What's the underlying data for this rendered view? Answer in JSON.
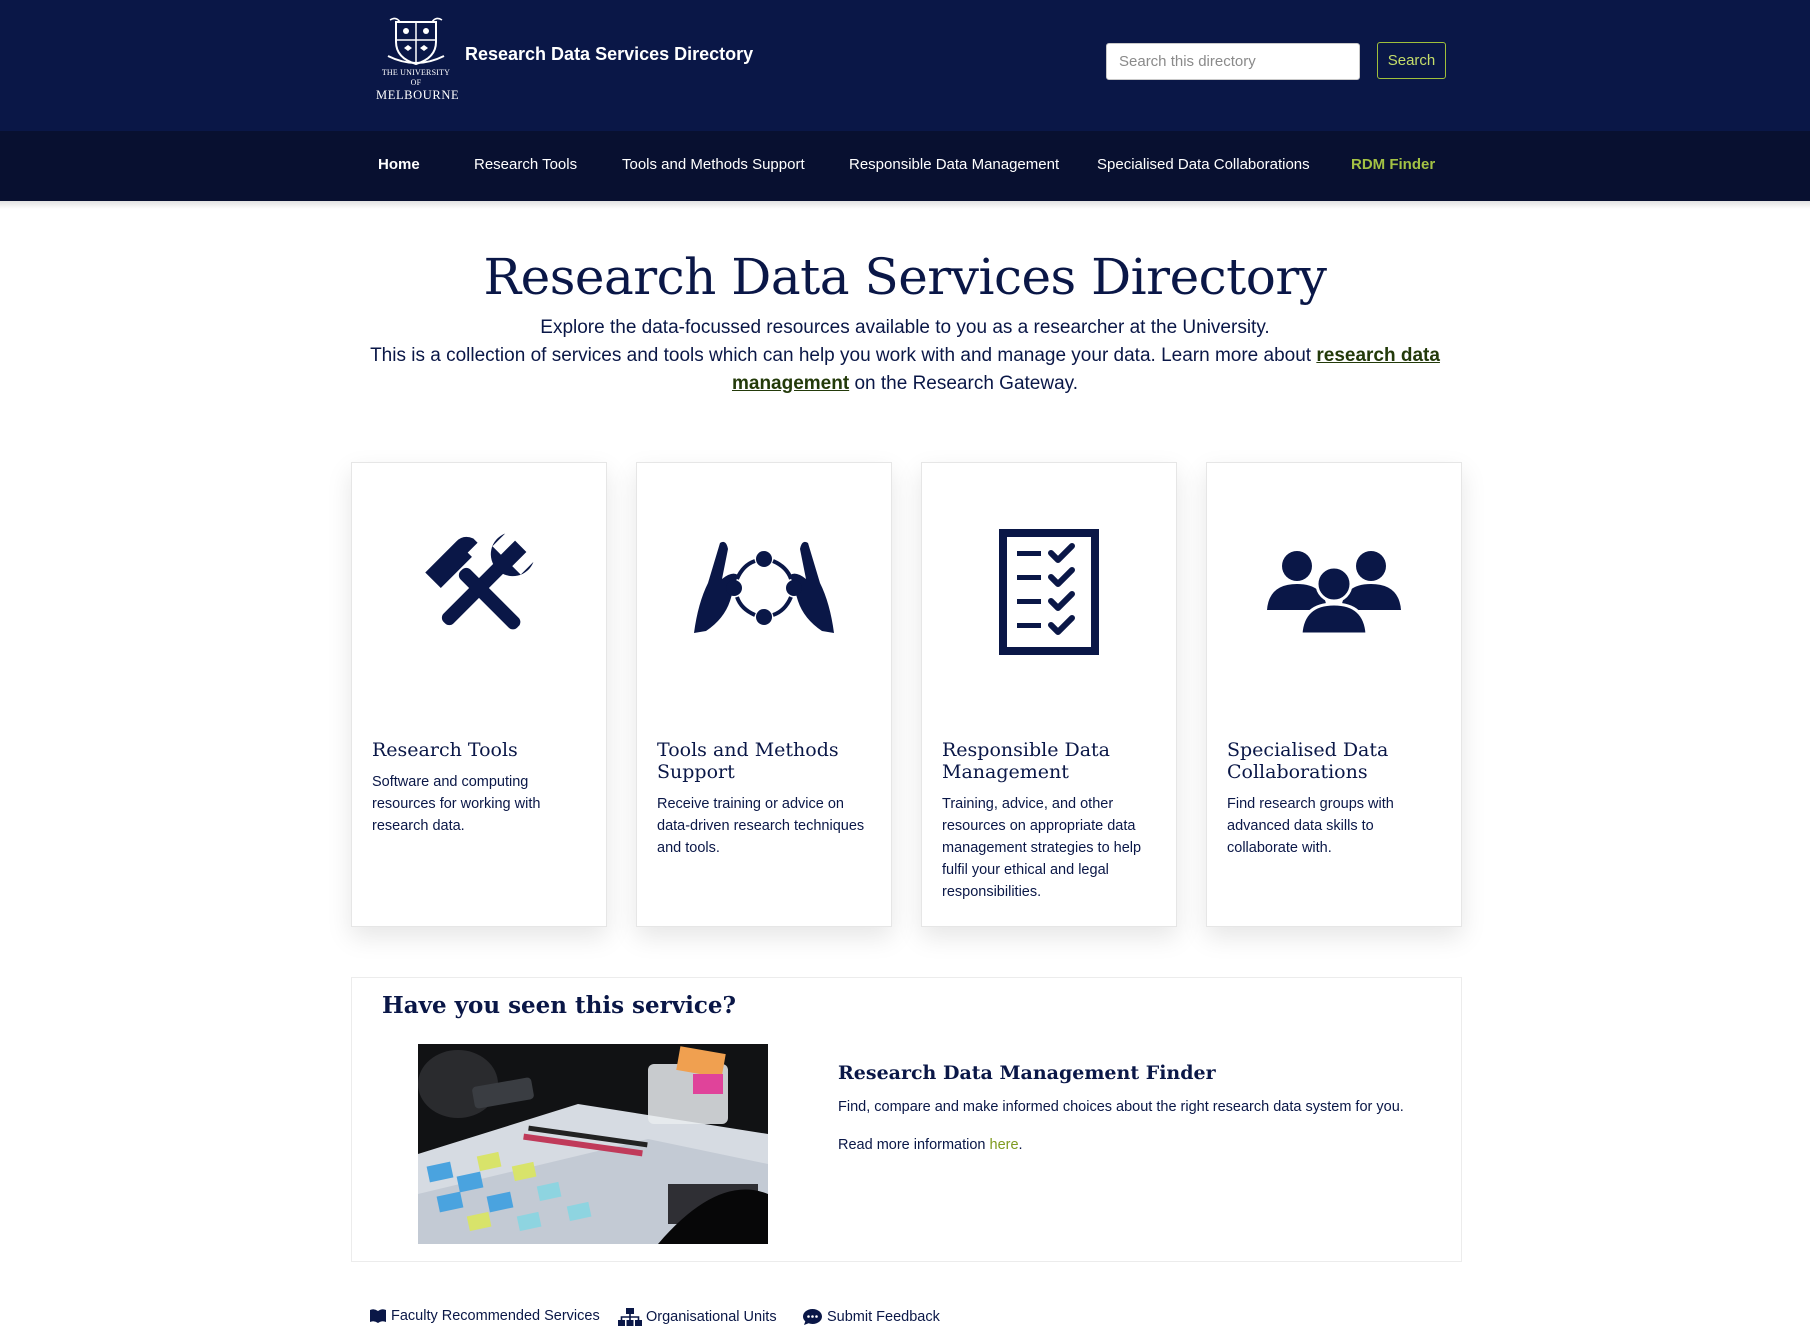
{
  "header": {
    "logo_small": "THE UNIVERSITY OF",
    "logo_big": "MELBOURNE",
    "site_title": "Research Data Services Directory",
    "search_placeholder": "Search this directory",
    "search_button": "Search"
  },
  "nav": {
    "items": [
      {
        "label": "Home"
      },
      {
        "label": "Research Tools"
      },
      {
        "label": "Tools and Methods Support"
      },
      {
        "label": "Responsible Data Management"
      },
      {
        "label": "Specialised Data Collaborations"
      },
      {
        "label": "RDM Finder"
      }
    ]
  },
  "hero": {
    "title": "Research Data Services Directory",
    "line1": "Explore the data-focussed resources available to you as a researcher at the University.",
    "line2_pre": "This is a collection of services and tools which can help you work with and manage your data. Learn more about ",
    "line2_link": "research data management",
    "line2_post": " on the Research Gateway."
  },
  "cards": [
    {
      "icon": "tools-icon",
      "title": "Research Tools",
      "desc": "Software and computing resources for working with research data."
    },
    {
      "icon": "hands-cycle-icon",
      "title": "Tools and Methods Support",
      "desc": "Receive training or advice on data-driven research techniques and tools."
    },
    {
      "icon": "checklist-icon",
      "title": "Responsible Data Management",
      "desc": "Training, advice, and other resources on appropriate data management strategies to help fulfil your ethical and legal responsibilities."
    },
    {
      "icon": "group-icon",
      "title": "Specialised Data Collaborations",
      "desc": "Find research groups with advanced data skills to collaborate with."
    }
  ],
  "featured": {
    "heading": "Have you seen this service?",
    "title": "Research Data Management Finder",
    "desc": "Find, compare and make informed choices about the right research data system for you.",
    "more_pre": "Read more information ",
    "more_link": "here",
    "more_post": "."
  },
  "footer_links": [
    {
      "icon": "book-icon",
      "label": "Faculty Recommended Services"
    },
    {
      "icon": "org-chart-icon",
      "label": "Organisational Units"
    },
    {
      "icon": "comment-icon",
      "label": "Submit Feedback"
    }
  ],
  "colors": {
    "navy": "#0a1747",
    "nav_bg": "#081030",
    "accent_green": "#a3c244",
    "link_dark_green": "#233a0a"
  }
}
